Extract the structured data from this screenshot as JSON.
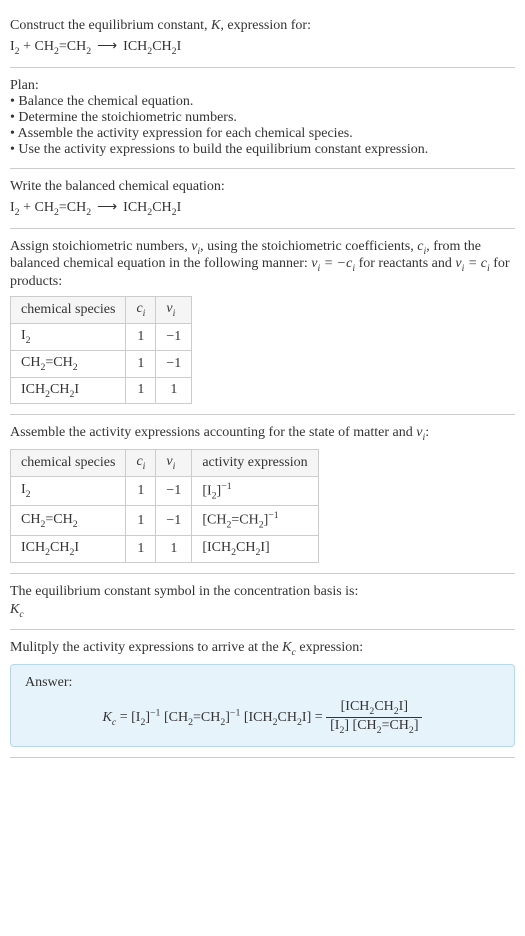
{
  "intro": {
    "line1": "Construct the equilibrium constant, ",
    "K": "K",
    "line1b": ", expression for:"
  },
  "plan": {
    "heading": "Plan:",
    "items": [
      "Balance the chemical equation.",
      "Determine the stoichiometric numbers.",
      "Assemble the activity expression for each chemical species.",
      "Use the activity expressions to build the equilibrium constant expression."
    ]
  },
  "balanced": {
    "heading": "Write the balanced chemical equation:"
  },
  "assign": {
    "text1": "Assign stoichiometric numbers, ",
    "nu": "ν",
    "text2": ", using the stoichiometric coefficients, ",
    "c": "c",
    "text3": ", from the balanced chemical equation in the following manner: ",
    "rel1a": "ν",
    "rel1b": " = −c",
    "text4": " for reactants and ",
    "rel2a": "ν",
    "rel2b": " = c",
    "text5": " for products:"
  },
  "table1": {
    "headers": {
      "species": "chemical species",
      "c": "c",
      "nu": "ν"
    },
    "rows": [
      {
        "species_html": "I<span class=\"sub\">2</span>",
        "c": "1",
        "nu": "−1"
      },
      {
        "species_html": "CH<span class=\"sub\">2</span>=CH<span class=\"sub\">2</span>",
        "c": "1",
        "nu": "−1"
      },
      {
        "species_html": "ICH<span class=\"sub\">2</span>CH<span class=\"sub\">2</span>I",
        "c": "1",
        "nu": "1"
      }
    ]
  },
  "assemble": {
    "text1": "Assemble the activity expressions accounting for the state of matter and ",
    "text2": ":"
  },
  "table2": {
    "headers": {
      "species": "chemical species",
      "c": "c",
      "nu": "ν",
      "activity": "activity expression"
    },
    "rows": [
      {
        "species_html": "I<span class=\"sub\">2</span>",
        "c": "1",
        "nu": "−1",
        "activity_html": "[I<span class=\"sub\">2</span>]<span class=\"sup\">−1</span>"
      },
      {
        "species_html": "CH<span class=\"sub\">2</span>=CH<span class=\"sub\">2</span>",
        "c": "1",
        "nu": "−1",
        "activity_html": "[CH<span class=\"sub\">2</span>=CH<span class=\"sub\">2</span>]<span class=\"sup\">−1</span>"
      },
      {
        "species_html": "ICH<span class=\"sub\">2</span>CH<span class=\"sub\">2</span>I",
        "c": "1",
        "nu": "1",
        "activity_html": "[ICH<span class=\"sub\">2</span>CH<span class=\"sub\">2</span>I]"
      }
    ]
  },
  "symbol": {
    "text": "The equilibrium constant symbol in the concentration basis is:",
    "Kc": "K",
    "Kc_sub": "c"
  },
  "multiply": {
    "text1": "Mulitply the activity expressions to arrive at the ",
    "Kc": "K",
    "text2": " expression:"
  },
  "answer": {
    "label": "Answer:"
  },
  "chart_data": {
    "type": "table",
    "tables": [
      {
        "title": "Stoichiometric numbers",
        "columns": [
          "chemical species",
          "c_i",
          "ν_i"
        ],
        "rows": [
          [
            "I2",
            1,
            -1
          ],
          [
            "CH2=CH2",
            1,
            -1
          ],
          [
            "ICH2CH2I",
            1,
            1
          ]
        ]
      },
      {
        "title": "Activity expressions",
        "columns": [
          "chemical species",
          "c_i",
          "ν_i",
          "activity expression"
        ],
        "rows": [
          [
            "I2",
            1,
            -1,
            "[I2]^-1"
          ],
          [
            "CH2=CH2",
            1,
            -1,
            "[CH2=CH2]^-1"
          ],
          [
            "ICH2CH2I",
            1,
            1,
            "[ICH2CH2I]"
          ]
        ]
      }
    ],
    "reaction": "I2 + CH2=CH2 ⟶ ICH2CH2I",
    "equilibrium_constant": "Kc = [I2]^-1 [CH2=CH2]^-1 [ICH2CH2I] = [ICH2CH2I] / ([I2][CH2=CH2])"
  }
}
